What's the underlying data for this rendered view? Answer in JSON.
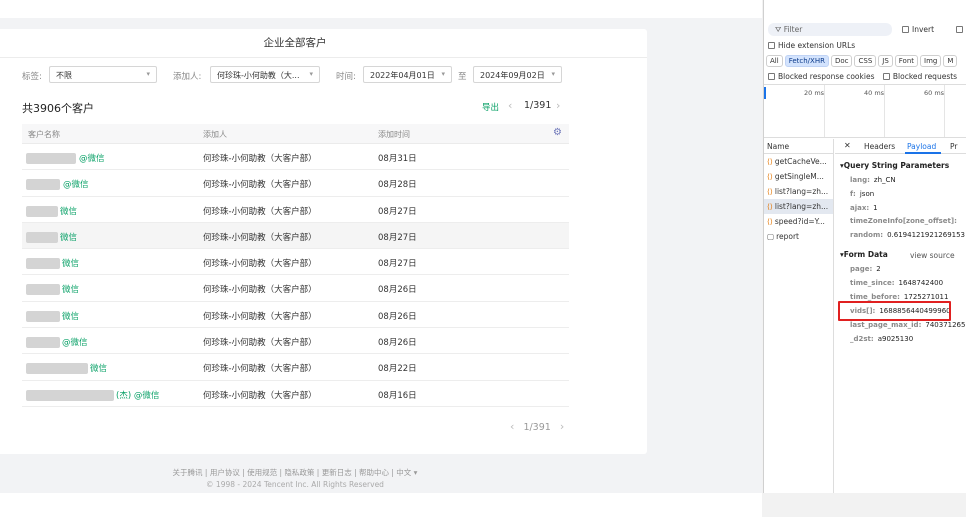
{
  "app": {
    "card_title": "企业全部客户",
    "filters": {
      "tag_label": "标签:",
      "tag_value": "不限",
      "adder_label": "添加人:",
      "adder_value": "何珍珠-小何助教（大...",
      "time_label": "时间:",
      "start_date": "2022年04月01日",
      "to_label": "至",
      "end_date": "2024年09月02日"
    },
    "count_text": "共3906个客户",
    "export_label": "导出",
    "pager": {
      "prev": "‹",
      "page_text": "1/391",
      "next": "›"
    },
    "columns": [
      "客户名称",
      "添加人",
      "添加时间"
    ],
    "settings_icon": "gear-icon",
    "rows": [
      {
        "name_suffix": "@微信",
        "adder": "何珍珠-小何助教（大客户部）",
        "date": "08月31日"
      },
      {
        "name_suffix": "@微信",
        "adder": "何珍珠-小何助教（大客户部）",
        "date": "08月28日"
      },
      {
        "name_suffix": "微信",
        "adder": "何珍珠-小何助教（大客户部）",
        "date": "08月27日"
      },
      {
        "name_suffix": "微信",
        "adder": "何珍珠-小何助教（大客户部）",
        "date": "08月27日"
      },
      {
        "name_suffix": "微信",
        "adder": "何珍珠-小何助教（大客户部）",
        "date": "08月27日"
      },
      {
        "name_suffix": "微信",
        "adder": "何珍珠-小何助教（大客户部）",
        "date": "08月26日"
      },
      {
        "name_suffix": "微信",
        "adder": "何珍珠-小何助教（大客户部）",
        "date": "08月26日"
      },
      {
        "name_suffix": "@微信",
        "adder": "何珍珠-小何助教（大客户部）",
        "date": "08月26日"
      },
      {
        "name_suffix": "微信",
        "adder": "何珍珠-小何助教（大客户部）",
        "date": "08月22日"
      },
      {
        "name_suffix": "(杰) @微信",
        "adder": "何珍珠-小何助教（大客户部）",
        "date": "08月16日"
      }
    ],
    "footer_links": "关于腾讯 | 用户协议 | 使用规范 | 隐私政策 | 更新日志 | 帮助中心 | 中文 ▾",
    "footer_copy": "© 1998 - 2024 Tencent Inc. All Rights Reserved"
  },
  "devtools": {
    "filter_placeholder": "Filter",
    "invert_label": "Invert",
    "hide_ext_label": "Hide extension URLs",
    "types": [
      "All",
      "Fetch/XHR",
      "Doc",
      "CSS",
      "JS",
      "Font",
      "Img",
      "M"
    ],
    "active_type": "Fetch/XHR",
    "blocked_cookies_label": "Blocked response cookies",
    "blocked_requests_label": "Blocked requests",
    "timeline_ticks": [
      "20 ms",
      "40 ms",
      "60 ms"
    ],
    "name_header": "Name",
    "requests": [
      {
        "label": "getCacheVe...",
        "kind": "xhr"
      },
      {
        "label": "getSingleM...",
        "kind": "xhr"
      },
      {
        "label": "list?lang=zh...",
        "kind": "xhr"
      },
      {
        "label": "list?lang=zh...",
        "kind": "xhr",
        "selected": true
      },
      {
        "label": "speed?id=Y...",
        "kind": "xhr"
      },
      {
        "label": "report",
        "kind": "doc"
      }
    ],
    "tabs": {
      "close": "✕",
      "headers": "Headers",
      "payload": "Payload",
      "preview": "Pr"
    },
    "query_title": "▾Query String Parameters",
    "query": [
      {
        "k": "lang:",
        "v": "zh_CN"
      },
      {
        "k": "f:",
        "v": "json"
      },
      {
        "k": "ajax:",
        "v": "1"
      },
      {
        "k": "timeZoneInfo[zone_offset]:",
        "v": ""
      },
      {
        "k": "random:",
        "v": "0.6194121921269153"
      }
    ],
    "form_title": "▾Form Data",
    "view_source": "view source",
    "form": [
      {
        "k": "page:",
        "v": "2"
      },
      {
        "k": "time_since:",
        "v": "1648742400"
      },
      {
        "k": "time_before:",
        "v": "1725271011"
      },
      {
        "k": "vids[]:",
        "v": "1688856440499960"
      },
      {
        "k": "last_page_max_id:",
        "v": "740371265"
      },
      {
        "k": "_d2st:",
        "v": "a9025130"
      }
    ]
  }
}
